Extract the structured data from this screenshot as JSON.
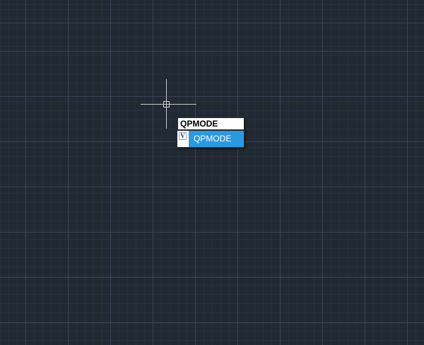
{
  "canvas": {
    "background_color": "#212a33",
    "grid_minor_color": "#28313b",
    "grid_major_color": "#394456"
  },
  "crosshair": {
    "color": "#c7cbd1"
  },
  "dynamic_input": {
    "value": "QPMODE"
  },
  "autocomplete": {
    "selection_color": "#2b99e0",
    "items": [
      {
        "label": "QPMODE",
        "icon": "system-variable-icon",
        "icon_letter": "V",
        "selected": true
      }
    ]
  }
}
